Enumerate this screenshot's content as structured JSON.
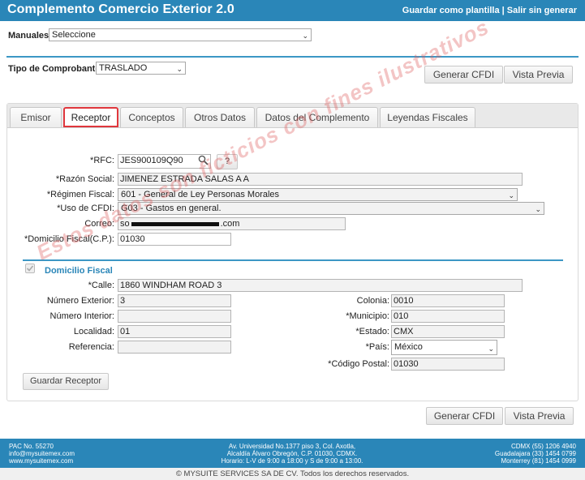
{
  "header": {
    "title": "Complemento Comercio Exterior 2.0",
    "save_template": "Guardar como plantilla",
    "separator": "|",
    "exit": "Salir sin generar"
  },
  "manuales": {
    "label": "Manuales:",
    "value": "Seleccione"
  },
  "tipo": {
    "label": "Tipo de Comprobante:",
    "value": "TRASLADO"
  },
  "actions": {
    "generar": "Generar CFDI",
    "vista": "Vista Previa"
  },
  "tabs": [
    {
      "label": "Emisor"
    },
    {
      "label": "Receptor"
    },
    {
      "label": "Conceptos"
    },
    {
      "label": "Otros Datos"
    },
    {
      "label": "Datos del Complemento"
    },
    {
      "label": "Leyendas Fiscales"
    }
  ],
  "receptor": {
    "rfc_label": "*RFC:",
    "rfc_value": "JES900109Q90",
    "help_btn": "?",
    "razon_label": "*Razón Social:",
    "razon_value": "JIMENEZ ESTRADA SALAS A A",
    "regimen_label": "*Régimen Fiscal:",
    "regimen_value": "601 - General de Ley Personas Morales",
    "uso_label": "*Uso de CFDI:",
    "uso_value": "G03 - Gastos en general.",
    "correo_label": "Correo:",
    "correo_prefix": "so",
    "correo_suffix": ".com",
    "domicilio_cp_label": "*Domicilio Fiscal(C.P.):",
    "domicilio_cp_value": "01030"
  },
  "domicilio": {
    "section_title": "Domicilio Fiscal",
    "calle_label": "*Calle:",
    "calle_value": "1860 WINDHAM ROAD 3",
    "num_ext_label": "Número Exterior:",
    "num_ext_value": "3",
    "num_int_label": "Número Interior:",
    "num_int_value": "",
    "localidad_label": "Localidad:",
    "localidad_value": "01",
    "referencia_label": "Referencia:",
    "referencia_value": "",
    "colonia_label": "Colonia:",
    "colonia_value": "0010",
    "municipio_label": "*Municipio:",
    "municipio_value": "010",
    "estado_label": "*Estado:",
    "estado_value": "CMX",
    "pais_label": "*País:",
    "pais_value": "México",
    "cp_label": "*Código Postal:",
    "cp_value": "01030",
    "save_btn": "Guardar Receptor"
  },
  "watermark": "Estos datos son ficticios con fines ilustrativos",
  "footer": {
    "left": [
      "PAC No. 55270",
      "info@mysuitemex.com",
      "www.mysuitemex.com"
    ],
    "center": [
      "Av. Universidad No.1377 piso 3, Col. Axotla,",
      "Alcaldía Álvaro Obregón, C.P. 01030, CDMX.",
      "Horario: L-V de 9:00 a 18:00 y S de 9:00 a 13:00."
    ],
    "right": [
      "CDMX (55) 1206 4940",
      "Guadalajara (33) 1454 0799",
      "Monterrey (81) 1454 0999"
    ],
    "copyright": "© MYSUITE SERVICES SA DE CV. Todos los derechos reservados."
  },
  "colors": {
    "brand": "#2a86b8",
    "active_tab_border": "#e0373d"
  }
}
